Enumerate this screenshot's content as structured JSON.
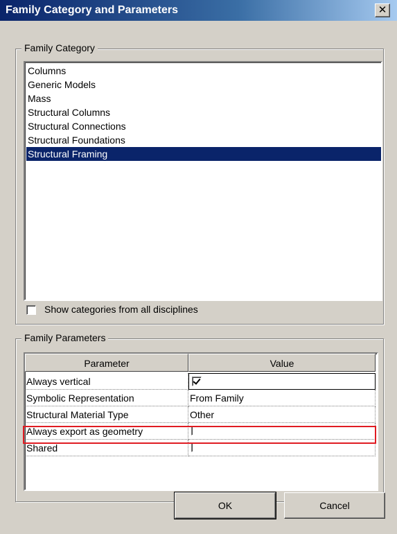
{
  "window": {
    "title": "Family Category and Parameters",
    "close_glyph": "✕"
  },
  "family_category": {
    "legend": "Family Category",
    "items": [
      "Columns",
      "Generic Models",
      "Mass",
      "Structural Columns",
      "Structural Connections",
      "Structural Foundations",
      "Structural Framing"
    ],
    "selected": "Structural Framing",
    "show_all_label": "Show categories from all disciplines",
    "show_all_checked": false
  },
  "family_parameters": {
    "legend": "Family Parameters",
    "columns": [
      "Parameter",
      "Value"
    ],
    "rows": [
      {
        "parameter": "Always vertical",
        "value": "",
        "checkbox": true,
        "checked": true
      },
      {
        "parameter": "Symbolic Representation",
        "value": "From Family",
        "checkbox": false
      },
      {
        "parameter": "Structural Material Type",
        "value": "Other",
        "checkbox": false
      },
      {
        "parameter": "Always export as geometry",
        "value": "",
        "checkbox": true,
        "checked": false,
        "highlighted": true
      },
      {
        "parameter": "Shared",
        "value": "",
        "checkbox": true,
        "checked": false
      }
    ]
  },
  "buttons": {
    "ok": "OK",
    "cancel": "Cancel"
  },
  "colors": {
    "selection": "#0a246a",
    "highlight": "#e01b22",
    "face": "#d4d0c8"
  }
}
